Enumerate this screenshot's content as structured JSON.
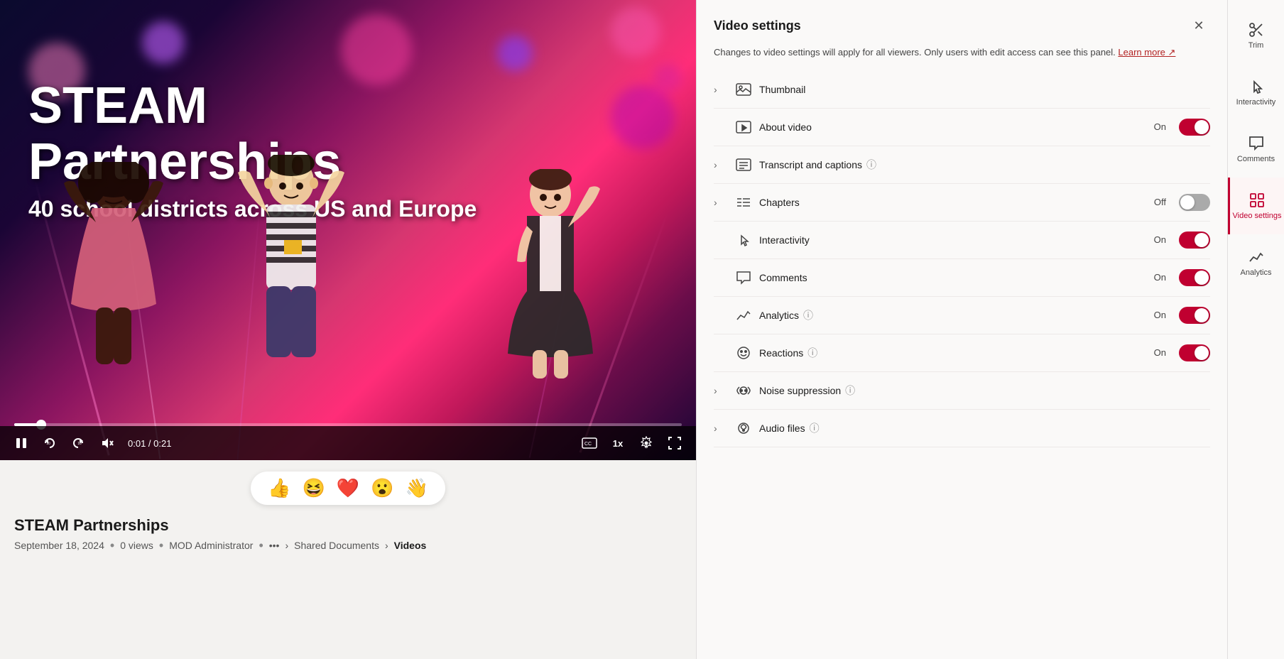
{
  "video": {
    "title_line1": "STEAM",
    "title_line2": "Partnerships",
    "title_line3": "40 school districts across US and Europe",
    "time_current": "0:01",
    "time_total": "0:21",
    "title": "STEAM Partnerships",
    "date": "September 18, 2024",
    "views": "0 views",
    "author": "MOD Administrator",
    "breadcrumb1": "Shared Documents",
    "breadcrumb2": "Videos",
    "progress_pct": 4
  },
  "reactions": {
    "emojis": [
      "👍",
      "😆",
      "❤️",
      "😮",
      "👋"
    ]
  },
  "settings_panel": {
    "title": "Video settings",
    "description": "Changes to video settings will apply for all viewers. Only users with edit access can see this panel.",
    "learn_more": "Learn more",
    "rows": [
      {
        "id": "thumbnail",
        "label": "Thumbnail",
        "icon": "image",
        "has_toggle": false,
        "has_chevron": true,
        "status": ""
      },
      {
        "id": "about_video",
        "label": "About video",
        "icon": "video",
        "has_toggle": true,
        "has_chevron": false,
        "status": "On",
        "toggle_on": true
      },
      {
        "id": "transcript",
        "label": "Transcript and captions",
        "icon": "transcript",
        "has_toggle": false,
        "has_chevron": true,
        "status": "",
        "has_info": true
      },
      {
        "id": "chapters",
        "label": "Chapters",
        "icon": "chapters",
        "has_toggle": true,
        "has_chevron": true,
        "status": "Off",
        "toggle_on": false
      },
      {
        "id": "interactivity",
        "label": "Interactivity",
        "icon": "interactivity",
        "has_toggle": true,
        "has_chevron": false,
        "status": "On",
        "toggle_on": true
      },
      {
        "id": "comments",
        "label": "Comments",
        "icon": "comments",
        "has_toggle": true,
        "has_chevron": false,
        "status": "On",
        "toggle_on": true
      },
      {
        "id": "analytics",
        "label": "Analytics",
        "icon": "analytics",
        "has_toggle": true,
        "has_chevron": false,
        "status": "On",
        "toggle_on": true,
        "has_info": true
      },
      {
        "id": "reactions",
        "label": "Reactions",
        "icon": "reactions",
        "has_toggle": true,
        "has_chevron": false,
        "status": "On",
        "toggle_on": true,
        "has_info": true
      },
      {
        "id": "noise_suppression",
        "label": "Noise suppression",
        "icon": "noise",
        "has_toggle": false,
        "has_chevron": true,
        "status": "",
        "has_info": true
      },
      {
        "id": "audio_files",
        "label": "Audio files",
        "icon": "audio",
        "has_toggle": false,
        "has_chevron": true,
        "status": "",
        "has_info": true
      }
    ]
  },
  "icon_bar": {
    "items": [
      {
        "id": "trim",
        "label": "Trim",
        "icon": "scissors"
      },
      {
        "id": "interactivity",
        "label": "Interactivity",
        "icon": "interactivity"
      },
      {
        "id": "comments",
        "label": "Comments",
        "icon": "comments"
      },
      {
        "id": "video_settings",
        "label": "Video settings",
        "icon": "settings",
        "active": true
      },
      {
        "id": "analytics",
        "label": "Analytics",
        "icon": "analytics"
      }
    ]
  }
}
